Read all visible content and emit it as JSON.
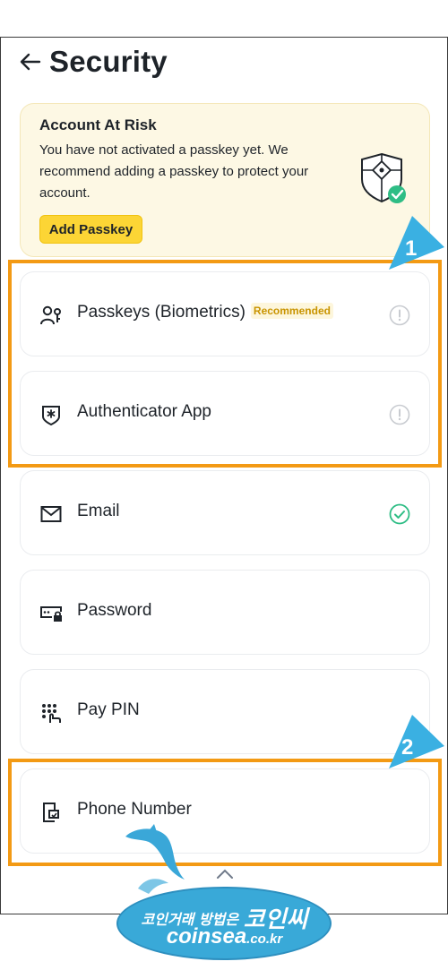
{
  "header": {
    "title": "Security"
  },
  "risk_banner": {
    "title": "Account At Risk",
    "description": "You have not activated a passkey yet. We recommend adding a passkey to protect your account.",
    "button_label": "Add Passkey"
  },
  "options": [
    {
      "label": "Passkeys (Biometrics)",
      "badge": "Recommended",
      "status": "warning",
      "icon": "passkey-users-icon"
    },
    {
      "label": "Authenticator App",
      "status": "warning",
      "icon": "authenticator-shield-icon"
    },
    {
      "label": "Email",
      "status": "verified",
      "icon": "email-icon"
    },
    {
      "label": "Password",
      "icon": "password-icon"
    },
    {
      "label": "Pay PIN",
      "icon": "pin-keypad-icon"
    },
    {
      "label": "Phone Number",
      "icon": "phone-icon"
    }
  ],
  "annotations": {
    "marker_1": "1",
    "marker_2": "2"
  },
  "watermark": {
    "line1_small": "코인거래 방법은",
    "line1_big": "코인씨",
    "domain_main": "coinsea",
    "domain_suffix": ".co.kr"
  },
  "colors": {
    "accent": "#fcd535",
    "highlight": "#f39a14",
    "success": "#2ebd85",
    "marker": "#3ab0e2"
  }
}
